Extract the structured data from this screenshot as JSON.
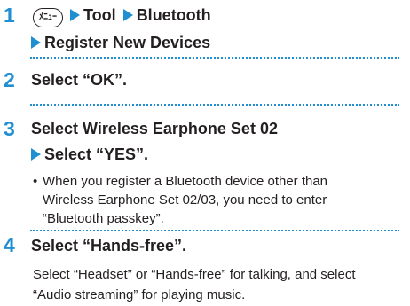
{
  "step1": {
    "number": "1",
    "menu_key_label": "ﾒﾆｭｰ",
    "path_1": "Tool",
    "path_2": "Bluetooth",
    "path_3": "Register New Devices"
  },
  "step2": {
    "number": "2",
    "text": "Select “OK”."
  },
  "step3": {
    "number": "3",
    "text": "Select Wireless Earphone Set 02",
    "sub": "Select “YES”.",
    "note_bullet": "•",
    "note_line1": "When you register a Bluetooth device other than",
    "note_line2": "Wireless Earphone Set 02/03, you need to enter",
    "note_line3": "“Bluetooth passkey”."
  },
  "step4": {
    "number": "4",
    "text": "Select “Hands-free”.",
    "desc_line1": "Select “Headset” or “Hands-free” for talking, and select",
    "desc_line2": "“Audio streaming” for playing music."
  },
  "colors": {
    "accent": "#1f8fd2",
    "text": "#231f20"
  }
}
